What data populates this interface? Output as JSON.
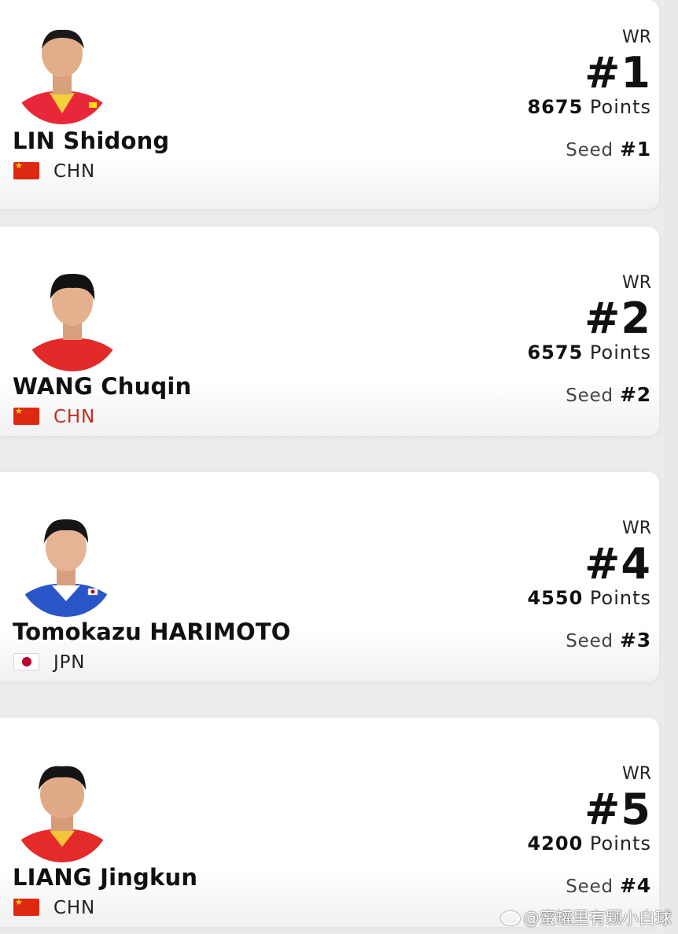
{
  "players": [
    {
      "name": "LIN Shidong",
      "country": "CHN",
      "flag": "china-flag-icon",
      "wr_label": "WR",
      "rank": "#1",
      "points": "8675",
      "points_label": "Points",
      "seed_label": "Seed",
      "seed": "#1",
      "jersey_color": "#e8283a"
    },
    {
      "name": "WANG Chuqin",
      "country": "CHN",
      "flag": "china-flag-icon",
      "wr_label": "WR",
      "rank": "#2",
      "points": "6575",
      "points_label": "Points",
      "seed_label": "Seed",
      "seed": "#2",
      "jersey_color": "#e22a2a"
    },
    {
      "name": "Tomokazu HARIMOTO",
      "country": "JPN",
      "flag": "japan-flag-icon",
      "wr_label": "WR",
      "rank": "#4",
      "points": "4550",
      "points_label": "Points",
      "seed_label": "Seed",
      "seed": "#3",
      "jersey_color": "#2a55c8"
    },
    {
      "name": "LIANG Jingkun",
      "country": "CHN",
      "flag": "china-flag-icon",
      "wr_label": "WR",
      "rank": "#5",
      "points": "4200",
      "points_label": "Points",
      "seed_label": "Seed",
      "seed": "#4",
      "jersey_color": "#e52a2a"
    }
  ],
  "watermark": "@蜜罐里有颗小白球",
  "colors": {
    "chn_red": "#de2910",
    "jpn_red": "#bc002d",
    "country_highlight": "#c62a1e"
  }
}
